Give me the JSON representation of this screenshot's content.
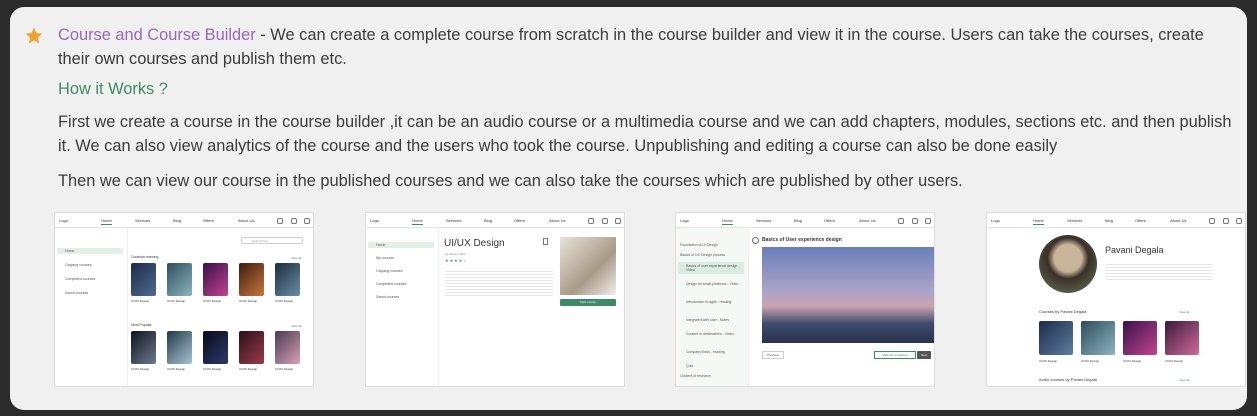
{
  "feature": {
    "title": "Course and Course Builder",
    "description": " - We can create a complete course from scratch in the course builder and view it in the course. Users can take the courses, create their own courses and publish them etc.",
    "how_title": "How it Works ?",
    "para1": "First we create a course in the course builder ,it can be an  audio course or a multimedia course and we can add chapters, modules, sections etc. and then publish it. We can also view analytics of the course and the users who took the course. Unpublishing and editing a course can also be done easily",
    "para2": "Then we can view our course in the published courses and we can also take the courses which are published by other users."
  },
  "screens": {
    "nav": {
      "logo": "Logo",
      "home": "Home",
      "services": "Services",
      "blog": "Blog",
      "offers": "Offers",
      "about": "About Us"
    },
    "s1": {
      "side": [
        "Home",
        "Ongoing courses",
        "Completed courses",
        "Saved courses"
      ],
      "continue": "Continue learning",
      "popular": "Most Popular",
      "view_all": "View all",
      "search": "Search here",
      "course": "UI/UX Design"
    },
    "s2": {
      "side": [
        "Home",
        "My courses",
        "Ongoing courses",
        "Completed courses",
        "Saved courses"
      ],
      "title": "UI/UX Design",
      "author": "by James Clear",
      "btn": "Start course"
    },
    "s3": {
      "side": [
        "Foundation of UI Design",
        "Basics of UX Design process",
        "Basics of user experience design - Video",
        "Design for small platforms - Video",
        "Introduction to agile - reading",
        "Integrated with user - Notes",
        "Content in deliverables - Video",
        "Company flows - reading",
        "Quiz",
        "Content of research"
      ],
      "title": "Basics of User experience design",
      "prev": "Previous",
      "mark": "Mark as completed",
      "next": "Next"
    },
    "s4": {
      "name": "Pavani Degala",
      "courses": "Courses by Pavani Degala",
      "audio": "Audio courses by Pavani Degala",
      "view_all": "View all",
      "course": "UI/UX Design"
    }
  },
  "colors": {
    "accent_purple": "#9a66bf",
    "accent_green": "#3d8a68",
    "star": "#f2a22c"
  }
}
